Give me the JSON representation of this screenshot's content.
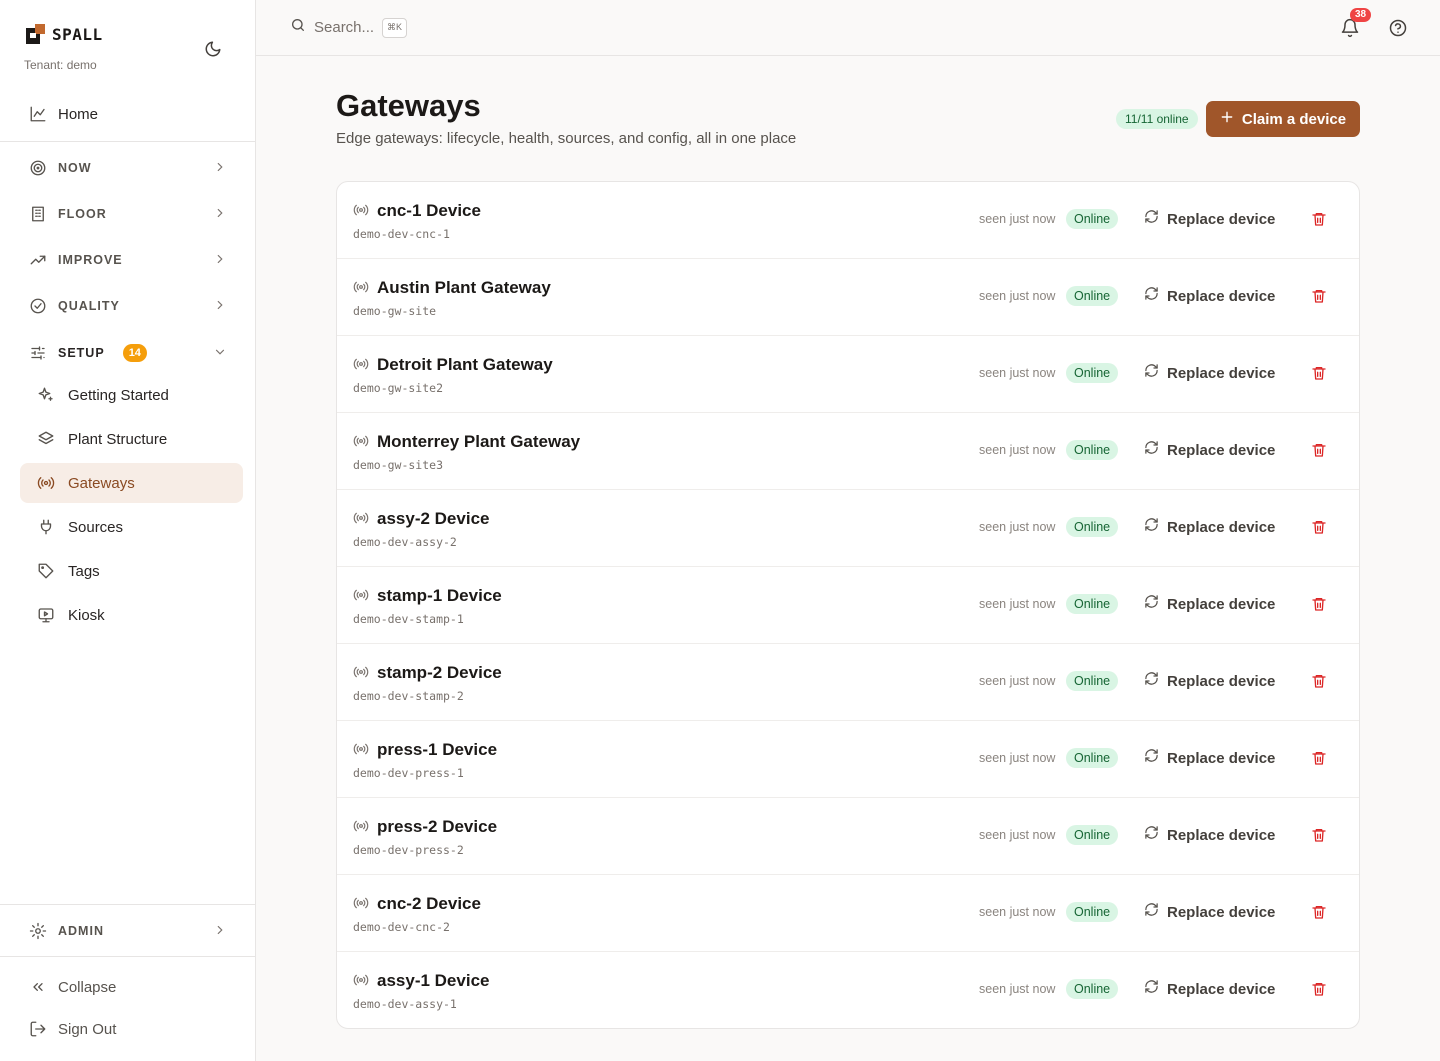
{
  "brand": {
    "name": "SPALL",
    "tenant": "Tenant: demo"
  },
  "nav": {
    "home": "Home",
    "sections": [
      {
        "label": "NOW"
      },
      {
        "label": "FLOOR"
      },
      {
        "label": "IMPROVE"
      },
      {
        "label": "QUALITY"
      }
    ],
    "setup": {
      "label": "SETUP",
      "badge": "14"
    },
    "setup_items": [
      {
        "label": "Getting Started",
        "icon": "sparkles-icon"
      },
      {
        "label": "Plant Structure",
        "icon": "layers-icon"
      },
      {
        "label": "Gateways",
        "icon": "radio-icon",
        "active": true
      },
      {
        "label": "Sources",
        "icon": "plug-icon"
      },
      {
        "label": "Tags",
        "icon": "tag-icon"
      },
      {
        "label": "Kiosk",
        "icon": "monitor-play-icon"
      }
    ],
    "admin": "ADMIN",
    "collapse": "Collapse",
    "signout": "Sign Out"
  },
  "topbar": {
    "search_placeholder": "Search...",
    "search_shortcut": "⌘K",
    "notification_count": "38"
  },
  "header": {
    "title": "Gateways",
    "subtitle": "Edge gateways: lifecycle, health, sources, and config, all in one place",
    "online_count": "11/11 online",
    "claim_label": "Claim a device"
  },
  "gateways": [
    {
      "name": "cnc-1 Device",
      "id": "demo-dev-cnc-1",
      "seen": "seen just now",
      "status": "Online",
      "action": "Replace device"
    },
    {
      "name": "Austin Plant Gateway",
      "id": "demo-gw-site",
      "seen": "seen just now",
      "status": "Online",
      "action": "Replace device"
    },
    {
      "name": "Detroit Plant Gateway",
      "id": "demo-gw-site2",
      "seen": "seen just now",
      "status": "Online",
      "action": "Replace device"
    },
    {
      "name": "Monterrey Plant Gateway",
      "id": "demo-gw-site3",
      "seen": "seen just now",
      "status": "Online",
      "action": "Replace device"
    },
    {
      "name": "assy-2 Device",
      "id": "demo-dev-assy-2",
      "seen": "seen just now",
      "status": "Online",
      "action": "Replace device"
    },
    {
      "name": "stamp-1 Device",
      "id": "demo-dev-stamp-1",
      "seen": "seen just now",
      "status": "Online",
      "action": "Replace device"
    },
    {
      "name": "stamp-2 Device",
      "id": "demo-dev-stamp-2",
      "seen": "seen just now",
      "status": "Online",
      "action": "Replace device"
    },
    {
      "name": "press-1 Device",
      "id": "demo-dev-press-1",
      "seen": "seen just now",
      "status": "Online",
      "action": "Replace device"
    },
    {
      "name": "press-2 Device",
      "id": "demo-dev-press-2",
      "seen": "seen just now",
      "status": "Online",
      "action": "Replace device"
    },
    {
      "name": "cnc-2 Device",
      "id": "demo-dev-cnc-2",
      "seen": "seen just now",
      "status": "Online",
      "action": "Replace device"
    },
    {
      "name": "assy-1 Device",
      "id": "demo-dev-assy-1",
      "seen": "seen just now",
      "status": "Online",
      "action": "Replace device"
    }
  ],
  "colors": {
    "accent": "#a0562a",
    "online_bg": "#d9f5e4",
    "online_text": "#166534",
    "danger": "#dc2626",
    "setup_badge": "#f59e0b"
  }
}
